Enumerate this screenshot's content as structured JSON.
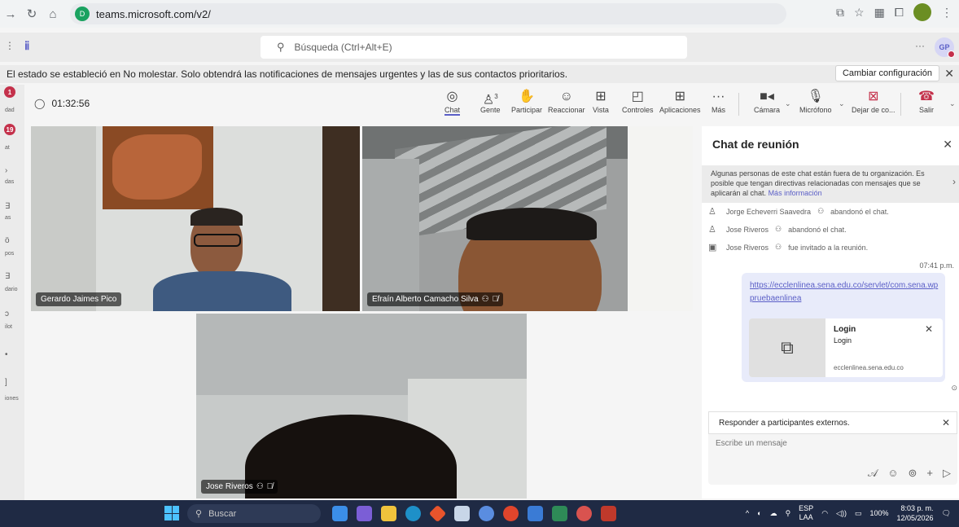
{
  "browser": {
    "url": "teams.microsoft.com/v2/",
    "site_icon": "D"
  },
  "header": {
    "search_placeholder": "Búsqueda (Ctrl+Alt+E)",
    "more": "···",
    "avatar_initials": "GP"
  },
  "notice": {
    "text": "El estado se estableció en No molestar. Solo obtendrá las notificaciones de mensajes urgentes y las de sus contactos prioritarios.",
    "button": "Cambiar configuración"
  },
  "rail": {
    "items": [
      {
        "badge": "1",
        "label": "dad"
      },
      {
        "badge": "19",
        "label": "at"
      },
      {
        "label": "das"
      },
      {
        "label": "as"
      },
      {
        "label": "pos"
      },
      {
        "label": "dario"
      },
      {
        "label": "ilot"
      },
      {
        "label": "iones"
      }
    ]
  },
  "meeting": {
    "timer": "01:32:56",
    "people_count": "3",
    "toolbar": {
      "chat": "Chat",
      "people": "Gente",
      "raise": "Participar",
      "react": "Reaccionar",
      "view": "Vista",
      "controls": "Controles",
      "apps": "Aplicaciones",
      "more": "Más",
      "camera": "Cámara",
      "mic": "Micrófono",
      "share": "Dejar de co...",
      "leave": "Salir"
    }
  },
  "participants": [
    {
      "name": "Gerardo Jaimes Pico"
    },
    {
      "name": "Efraín Alberto Camacho Silva"
    },
    {
      "name": "Jose Riveros"
    }
  ],
  "chat": {
    "title": "Chat de reunión",
    "external_notice": "Algunas personas de este chat están fuera de tu organización. Es posible que tengan directivas relacionadas con mensajes que se aplicarán al chat.",
    "external_link": "Más información",
    "system_messages": [
      {
        "name": "Jorge Echeverri Saavedra",
        "action": "abandonó el chat."
      },
      {
        "name": "Jose Riveros",
        "action": "abandonó el chat."
      },
      {
        "name": "Jose Riveros",
        "action": "fue invitado a la reunión."
      }
    ],
    "message_time": "07:41 p.m.",
    "message_link": "https://ecclenlinea.sena.edu.co/servlet/com.sena.wppruebaenlinea",
    "card": {
      "title": "Login",
      "subtitle": "Login",
      "domain": "ecclenlinea.sena.edu.co"
    },
    "reply_header": "Responder a participantes externos.",
    "reply_placeholder": "Escribe un mensaje"
  },
  "taskbar": {
    "search": "Buscar",
    "lang1": "ESP",
    "lang2": "LAA",
    "battery": "100%",
    "time": "8:03 p. m.",
    "date": "12/05/2026"
  },
  "colors": {
    "brand": "#5b5fc7",
    "leave": "#c4314b",
    "taskbar": "#1f2a44"
  }
}
